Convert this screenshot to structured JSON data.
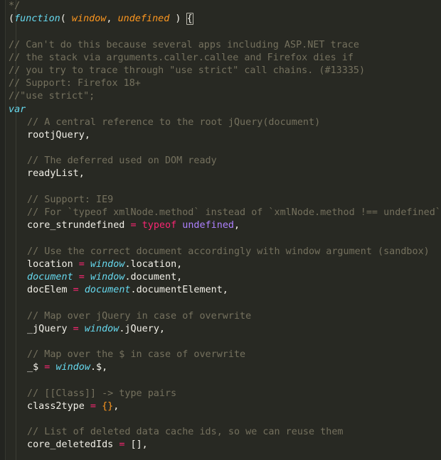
{
  "editor": {
    "theme_name": "monokai-dark",
    "background_color": "#282923",
    "gutter_color": "#232420",
    "indent_guide_color": "#3c3e35",
    "language": "javascript",
    "font_size_px": 13.4,
    "line_height_px": 18.2,
    "colors": {
      "comment": "#75715e",
      "plain": "#f2f0e8",
      "keyword": "#66d9ef",
      "parameter": "#fd971f",
      "operator": "#f92672",
      "constant": "#ae81ff",
      "brace": "#fd971f"
    }
  },
  "code_lines": [
    {
      "id": "l1",
      "indent": 0,
      "tokens": [
        {
          "t": "*/",
          "c": "comment"
        }
      ]
    },
    {
      "id": "l2",
      "indent": 0,
      "tokens": [
        {
          "t": "(",
          "c": "plain"
        },
        {
          "t": "function",
          "c": "keyword"
        },
        {
          "t": "( ",
          "c": "plain"
        },
        {
          "t": "window",
          "c": "param"
        },
        {
          "t": ", ",
          "c": "plain"
        },
        {
          "t": "undefined",
          "c": "param"
        },
        {
          "t": " ) ",
          "c": "plain"
        },
        {
          "t": "{",
          "c": "bracket-box"
        }
      ]
    },
    {
      "id": "l3",
      "indent": 0,
      "tokens": []
    },
    {
      "id": "l4",
      "indent": 0,
      "tokens": [
        {
          "t": "// Can't do this because several apps including ASP.NET trace",
          "c": "comment"
        }
      ]
    },
    {
      "id": "l5",
      "indent": 0,
      "tokens": [
        {
          "t": "// the stack via arguments.caller.callee and Firefox dies if",
          "c": "comment"
        }
      ]
    },
    {
      "id": "l6",
      "indent": 0,
      "tokens": [
        {
          "t": "// you try to trace through \"use strict\" call chains. (#13335)",
          "c": "comment"
        }
      ]
    },
    {
      "id": "l7",
      "indent": 0,
      "tokens": [
        {
          "t": "// Support: Firefox 18+",
          "c": "comment"
        }
      ]
    },
    {
      "id": "l8",
      "indent": 0,
      "tokens": [
        {
          "t": "//\"use strict\";",
          "c": "comment"
        }
      ]
    },
    {
      "id": "l9",
      "indent": 0,
      "tokens": [
        {
          "t": "var",
          "c": "keyword"
        }
      ]
    },
    {
      "id": "l10",
      "indent": 1,
      "tokens": [
        {
          "t": "// A central reference to the root jQuery(document)",
          "c": "comment"
        }
      ]
    },
    {
      "id": "l11",
      "indent": 1,
      "tokens": [
        {
          "t": "rootjQuery,",
          "c": "plain"
        }
      ]
    },
    {
      "id": "l12",
      "indent": 0,
      "tokens": []
    },
    {
      "id": "l13",
      "indent": 1,
      "tokens": [
        {
          "t": "// The deferred used on DOM ready",
          "c": "comment"
        }
      ]
    },
    {
      "id": "l14",
      "indent": 1,
      "tokens": [
        {
          "t": "readyList,",
          "c": "plain"
        }
      ]
    },
    {
      "id": "l15",
      "indent": 0,
      "tokens": []
    },
    {
      "id": "l16",
      "indent": 1,
      "tokens": [
        {
          "t": "// Support: IE9",
          "c": "comment"
        }
      ]
    },
    {
      "id": "l17",
      "indent": 1,
      "tokens": [
        {
          "t": "// For `typeof xmlNode.method` instead of `xmlNode.method !== undefined`",
          "c": "comment"
        }
      ]
    },
    {
      "id": "l18",
      "indent": 1,
      "tokens": [
        {
          "t": "core_strundefined ",
          "c": "plain"
        },
        {
          "t": "=",
          "c": "operator"
        },
        {
          "t": " ",
          "c": "plain"
        },
        {
          "t": "typeof",
          "c": "typeof"
        },
        {
          "t": " ",
          "c": "plain"
        },
        {
          "t": "undefined",
          "c": "constant"
        },
        {
          "t": ",",
          "c": "plain"
        }
      ]
    },
    {
      "id": "l19",
      "indent": 0,
      "tokens": []
    },
    {
      "id": "l20",
      "indent": 1,
      "tokens": [
        {
          "t": "// Use the correct document accordingly with window argument (sandbox)",
          "c": "comment"
        }
      ]
    },
    {
      "id": "l21",
      "indent": 1,
      "tokens": [
        {
          "t": "location ",
          "c": "plain"
        },
        {
          "t": "=",
          "c": "operator"
        },
        {
          "t": " ",
          "c": "plain"
        },
        {
          "t": "window",
          "c": "paramref"
        },
        {
          "t": ".location,",
          "c": "plain"
        }
      ]
    },
    {
      "id": "l22",
      "indent": 1,
      "tokens": [
        {
          "t": "document",
          "c": "paramref"
        },
        {
          "t": " ",
          "c": "plain"
        },
        {
          "t": "=",
          "c": "operator"
        },
        {
          "t": " ",
          "c": "plain"
        },
        {
          "t": "window",
          "c": "paramref"
        },
        {
          "t": ".document,",
          "c": "plain"
        }
      ]
    },
    {
      "id": "l23",
      "indent": 1,
      "tokens": [
        {
          "t": "docElem ",
          "c": "plain"
        },
        {
          "t": "=",
          "c": "operator"
        },
        {
          "t": " ",
          "c": "plain"
        },
        {
          "t": "document",
          "c": "paramref"
        },
        {
          "t": ".documentElement,",
          "c": "plain"
        }
      ]
    },
    {
      "id": "l24",
      "indent": 0,
      "tokens": []
    },
    {
      "id": "l25",
      "indent": 1,
      "tokens": [
        {
          "t": "// Map over jQuery in case of overwrite",
          "c": "comment"
        }
      ]
    },
    {
      "id": "l26",
      "indent": 1,
      "tokens": [
        {
          "t": "_jQuery ",
          "c": "plain"
        },
        {
          "t": "=",
          "c": "operator"
        },
        {
          "t": " ",
          "c": "plain"
        },
        {
          "t": "window",
          "c": "paramref"
        },
        {
          "t": ".jQuery,",
          "c": "plain"
        }
      ]
    },
    {
      "id": "l27",
      "indent": 0,
      "tokens": []
    },
    {
      "id": "l28",
      "indent": 1,
      "tokens": [
        {
          "t": "// Map over the $ in case of overwrite",
          "c": "comment"
        }
      ]
    },
    {
      "id": "l29",
      "indent": 1,
      "tokens": [
        {
          "t": "_$ ",
          "c": "plain"
        },
        {
          "t": "=",
          "c": "operator"
        },
        {
          "t": " ",
          "c": "plain"
        },
        {
          "t": "window",
          "c": "paramref"
        },
        {
          "t": ".$,",
          "c": "plain"
        }
      ]
    },
    {
      "id": "l30",
      "indent": 0,
      "tokens": []
    },
    {
      "id": "l31",
      "indent": 1,
      "tokens": [
        {
          "t": "// [[Class]] -> type pairs",
          "c": "comment"
        }
      ]
    },
    {
      "id": "l32",
      "indent": 1,
      "tokens": [
        {
          "t": "class2type ",
          "c": "plain"
        },
        {
          "t": "=",
          "c": "operator"
        },
        {
          "t": " ",
          "c": "plain"
        },
        {
          "t": "{}",
          "c": "brace"
        },
        {
          "t": ",",
          "c": "plain"
        }
      ]
    },
    {
      "id": "l33",
      "indent": 0,
      "tokens": []
    },
    {
      "id": "l34",
      "indent": 1,
      "tokens": [
        {
          "t": "// List of deleted data cache ids, so we can reuse them",
          "c": "comment"
        }
      ]
    },
    {
      "id": "l35",
      "indent": 1,
      "tokens": [
        {
          "t": "core_deletedIds ",
          "c": "plain"
        },
        {
          "t": "=",
          "c": "operator"
        },
        {
          "t": " ",
          "c": "plain"
        },
        {
          "t": "[],",
          "c": "plain"
        }
      ]
    }
  ]
}
